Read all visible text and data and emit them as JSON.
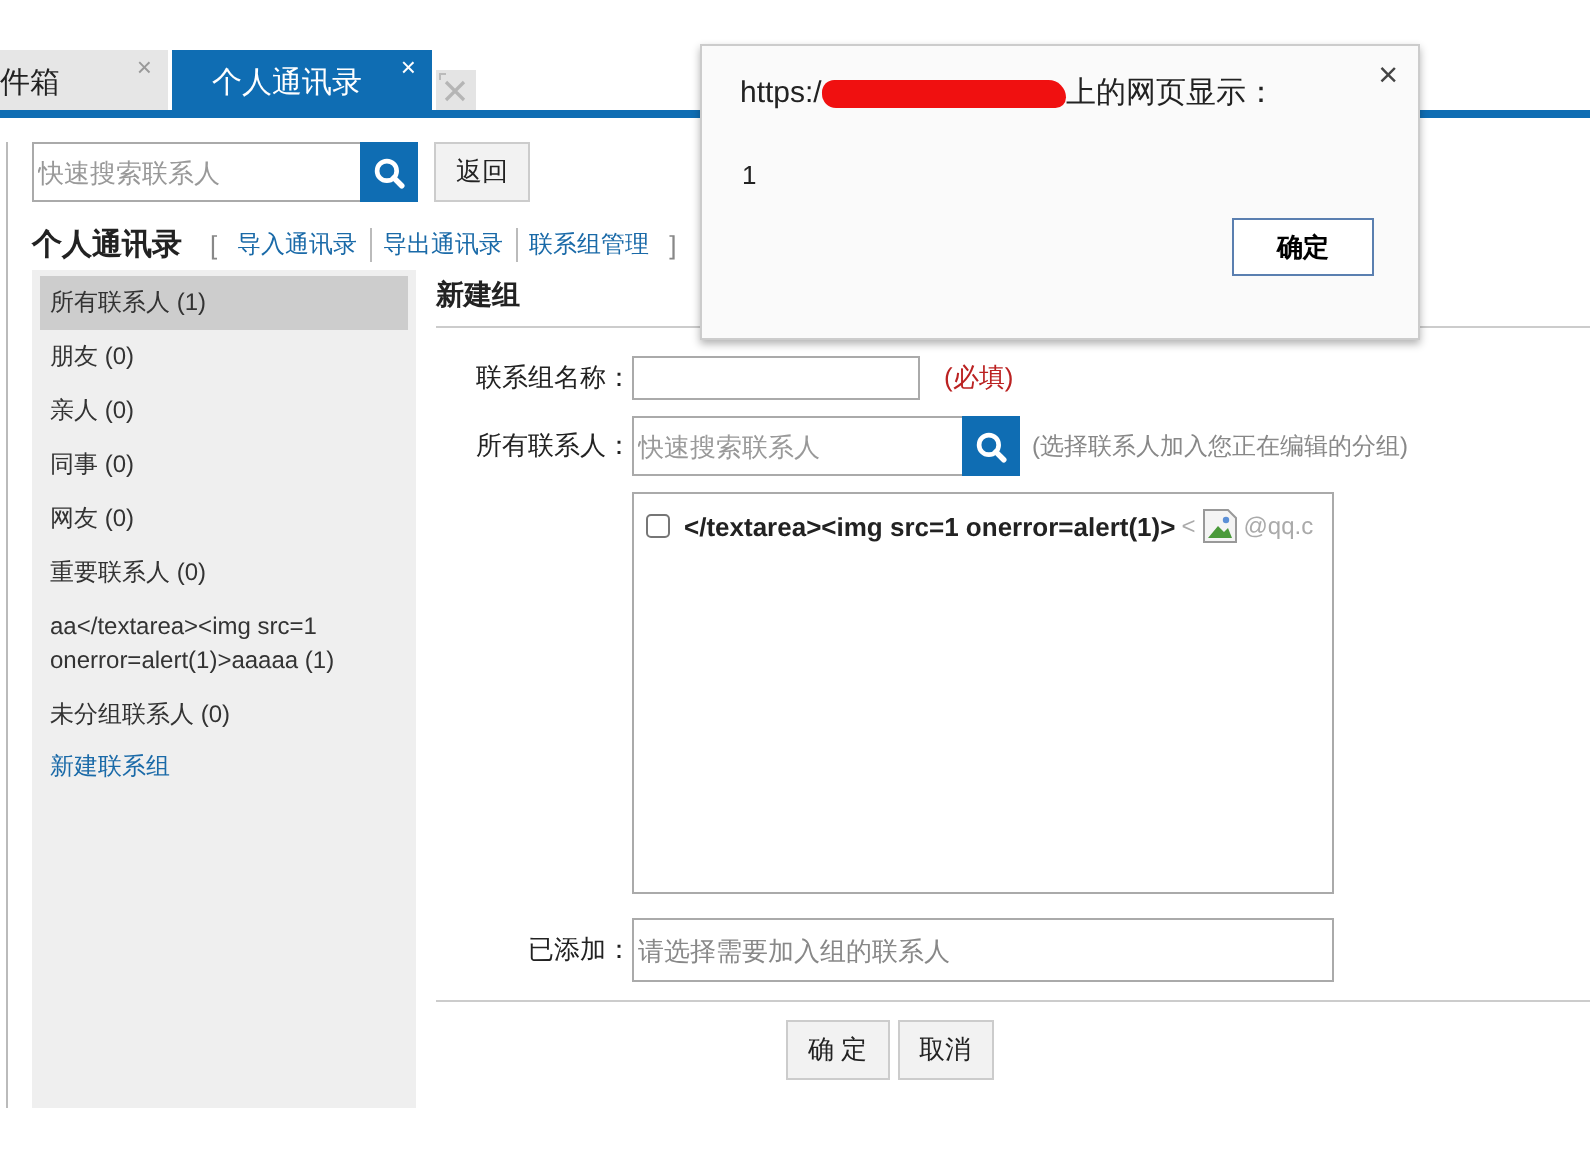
{
  "tabs": [
    {
      "label": "件箱",
      "selected": false,
      "close": "×"
    },
    {
      "label": "个人通讯录",
      "selected": true,
      "close": "×"
    }
  ],
  "toolbar": {
    "search_placeholder": "快速搜索联系人",
    "back_button": "返回"
  },
  "heading": {
    "title": "个人通讯录",
    "open_bracket": "[",
    "links": [
      "导入通讯录",
      "导出通讯录",
      "联系组管理"
    ],
    "close_bracket": "]"
  },
  "groups": [
    {
      "label": "所有联系人 (1)",
      "selected": true
    },
    {
      "label": "朋友 (0)",
      "selected": false
    },
    {
      "label": "亲人 (0)",
      "selected": false
    },
    {
      "label": "同事 (0)",
      "selected": false
    },
    {
      "label": "网友 (0)",
      "selected": false
    },
    {
      "label": "重要联系人 (0)",
      "selected": false
    },
    {
      "label": "aa</textarea><img src=1 onerror=alert(1)>aaaaa (1)",
      "selected": false
    },
    {
      "label": "未分组联系人 (0)",
      "selected": false
    }
  ],
  "new_group_link": "新建联系组",
  "form": {
    "title": "新建组",
    "name_label": "联系组名称：",
    "required_hint": "(必填)",
    "contacts_label": "所有联系人：",
    "search_placeholder": "快速搜索联系人",
    "select_hint": "(选择联系人加入您正在编辑的分组)",
    "contacts": [
      {
        "name": "</textarea><img src=1 onerror=alert(1)>",
        "bracket": "<",
        "email": "@qq.c",
        "checked": false
      }
    ],
    "added_label": "已添加：",
    "added_placeholder": "请选择需要加入组的联系人",
    "buttons": [
      "确 定",
      "取消"
    ]
  },
  "dialog": {
    "title_prefix": "https:/",
    "title_suffix": "上的网页显示：",
    "message": "1",
    "ok_button": "确定",
    "close": "×"
  }
}
